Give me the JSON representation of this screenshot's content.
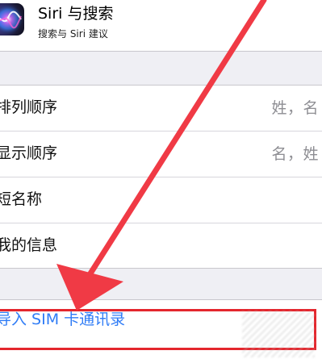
{
  "siri": {
    "title": "Siri 与搜索",
    "subtitle": "搜索与 Siri 建议",
    "icon": "siri-icon"
  },
  "contacts_settings": {
    "rows": [
      {
        "label": "排列顺序",
        "value": "姓，名"
      },
      {
        "label": "显示顺序",
        "value": "名，姓"
      },
      {
        "label": "短名称",
        "value": ""
      },
      {
        "label": "我的信息",
        "value": ""
      }
    ]
  },
  "import": {
    "label": "导入 SIM 卡通讯录"
  },
  "annotations": {
    "highlight_color": "#e4262d",
    "arrow_color": "#f03a45"
  },
  "colors": {
    "background": "#efeff4",
    "link_blue": "#2f7cf6",
    "secondary_text": "#8e8e93"
  }
}
